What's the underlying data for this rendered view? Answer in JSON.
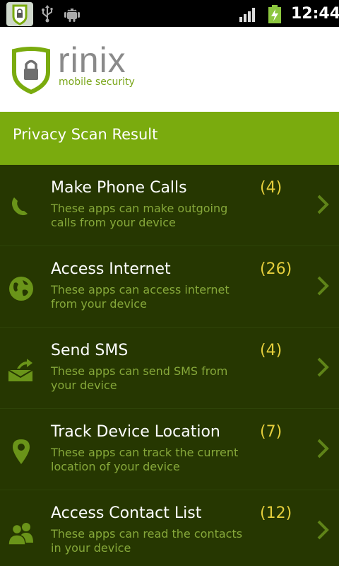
{
  "status_bar": {
    "time": "12:44",
    "icons": [
      "app-shield-icon",
      "usb-icon",
      "android-debug-icon",
      "signal-icon",
      "battery-charging-icon"
    ]
  },
  "logo": {
    "word": "rinix",
    "tagline": "mobile security"
  },
  "header": {
    "title": "Privacy Scan Result"
  },
  "colors": {
    "accent": "#7aab0e",
    "list_bg": "#263701",
    "count": "#e5cf3c",
    "desc": "#86a83a"
  },
  "items": [
    {
      "title": "Make Phone Calls",
      "count": "(4)",
      "desc": "These apps can make outgoing calls from your device",
      "icon": "phone-icon"
    },
    {
      "title": "Access Internet",
      "count": "(26)",
      "desc": "These apps can access internet from your device",
      "icon": "globe-icon"
    },
    {
      "title": "Send SMS",
      "count": "(4)",
      "desc": "These apps can send SMS from your device",
      "icon": "envelope-send-icon"
    },
    {
      "title": "Track Device Location",
      "count": "(7)",
      "desc": "These apps can track the current location of your device",
      "icon": "location-pin-icon"
    },
    {
      "title": "Access Contact List",
      "count": "(12)",
      "desc": "These apps can read the contacts in your device",
      "icon": "contacts-icon"
    }
  ]
}
